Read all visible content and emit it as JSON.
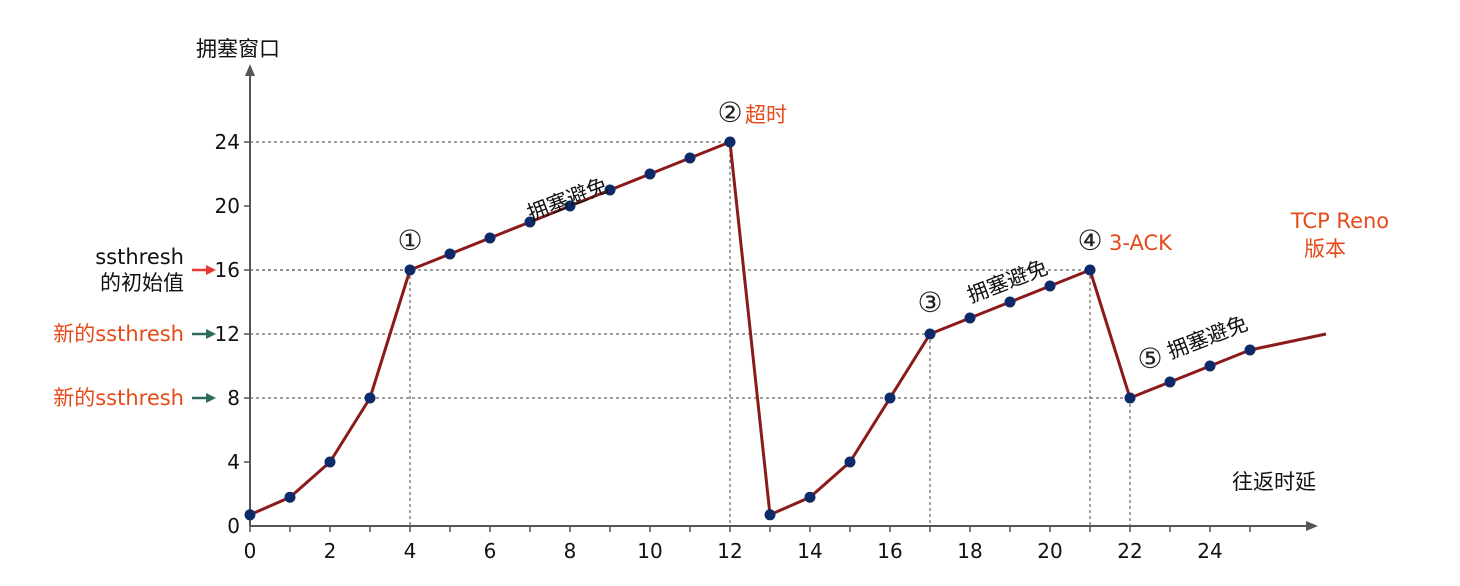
{
  "chart_data": {
    "type": "line",
    "ylabel": "拥塞窗口",
    "xlabel": "往返时延",
    "xlim": [
      0,
      27
    ],
    "ylim": [
      0,
      30
    ],
    "x_ticks": [
      "0",
      "2",
      "4",
      "6",
      "8",
      "10",
      "12",
      "14",
      "16",
      "18",
      "20",
      "22",
      "24"
    ],
    "y_ticks": [
      "0",
      "4",
      "8",
      "12",
      "16",
      "20",
      "24"
    ],
    "grid": false,
    "series": [
      {
        "x": [
          0,
          1,
          2,
          3,
          4,
          5,
          6,
          7,
          8,
          9,
          10,
          11,
          12,
          13,
          14,
          15,
          16,
          17,
          18,
          19,
          20,
          21,
          22,
          23,
          24,
          25,
          26.9
        ],
        "y": [
          0.7,
          1.8,
          4,
          8,
          16,
          17,
          18,
          19,
          20,
          21,
          22,
          23,
          24,
          0.7,
          1.8,
          4,
          8,
          12,
          13,
          14,
          15,
          16,
          8,
          9,
          10,
          11,
          12
        ],
        "markers": [
          true,
          true,
          true,
          true,
          true,
          true,
          true,
          true,
          true,
          true,
          true,
          true,
          true,
          true,
          true,
          true,
          true,
          true,
          true,
          true,
          true,
          true,
          true,
          true,
          true,
          true,
          false
        ],
        "color": "#8b1a1a",
        "marker_color": "#0d2a6b"
      }
    ],
    "left_labels": [
      {
        "y": 16,
        "lines": [
          "ssthresh",
          "的初始值"
        ],
        "color": "#111111",
        "arrow_color": "#e53935"
      },
      {
        "y": 12,
        "lines": [
          "新的ssthresh"
        ],
        "color": "#e64a19",
        "arrow_color": "#2e6b5e"
      },
      {
        "y": 8,
        "lines": [
          "新的ssthresh"
        ],
        "color": "#e64a19",
        "arrow_color": "#2e6b5e"
      }
    ],
    "annotations": [
      {
        "text": "①",
        "x": 4,
        "y": 16,
        "color": "#222222"
      },
      {
        "text": "②",
        "x": 12,
        "y": 24,
        "color": "#222222"
      },
      {
        "text": "超时",
        "x": 12,
        "y": 24,
        "color": "#e64a19"
      },
      {
        "text": "③",
        "x": 17,
        "y": 12,
        "color": "#222222"
      },
      {
        "text": "④",
        "x": 21,
        "y": 16,
        "color": "#222222"
      },
      {
        "text": "3-ACK",
        "x": 21,
        "y": 16,
        "color": "#e64a19"
      },
      {
        "text": "⑤",
        "x": 22,
        "y": 8,
        "color": "#222222"
      },
      {
        "text": "拥塞避免",
        "x": 8,
        "y": 20,
        "color": "#111111"
      },
      {
        "text": "拥塞避免",
        "x": 19,
        "y": 14,
        "color": "#111111"
      },
      {
        "text": "拥塞避免",
        "x": 24,
        "y": 10,
        "color": "#111111"
      },
      {
        "text": "TCP Reno",
        "x": 26.5,
        "y": 14,
        "color": "#e64a19"
      },
      {
        "text": "版本",
        "x": 26.5,
        "y": 14,
        "color": "#e64a19"
      }
    ],
    "guides": [
      {
        "x": 4,
        "y": 16
      },
      {
        "x": 12,
        "y": 24
      },
      {
        "x": 17,
        "y": 12
      },
      {
        "x": 21,
        "y": 16
      },
      {
        "x": 22,
        "y": 8
      }
    ]
  }
}
